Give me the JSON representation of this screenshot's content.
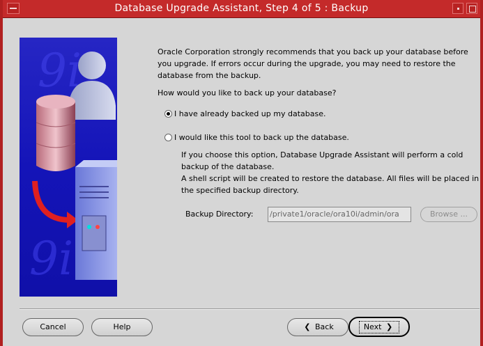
{
  "window": {
    "title": "Database Upgrade Assistant, Step 4 of 5 : Backup"
  },
  "main": {
    "intro": "Oracle Corporation strongly recommends that you back up your database before you upgrade. If errors occur during the upgrade, you may need to restore the database from the backup.",
    "question": "How would you like to back up your database?",
    "options": [
      {
        "label": "I have already backed up my database.",
        "selected": true
      },
      {
        "label": "I would like this tool to back up the database.",
        "selected": false
      }
    ],
    "option_description_1": "If you choose this option, Database Upgrade Assistant will perform a cold backup of the database.",
    "option_description_2": "A shell script will be created to restore the database. All files will be placed in the specified backup directory.",
    "backup_directory": {
      "label": "Backup Directory:",
      "value": "/private1/oracle/ora10i/admin/ora"
    },
    "browse_label": "Browse ..."
  },
  "buttons": {
    "cancel": "Cancel",
    "help": "Help",
    "back": "Back",
    "next": "Next"
  },
  "graphic": {
    "text": "9i"
  }
}
